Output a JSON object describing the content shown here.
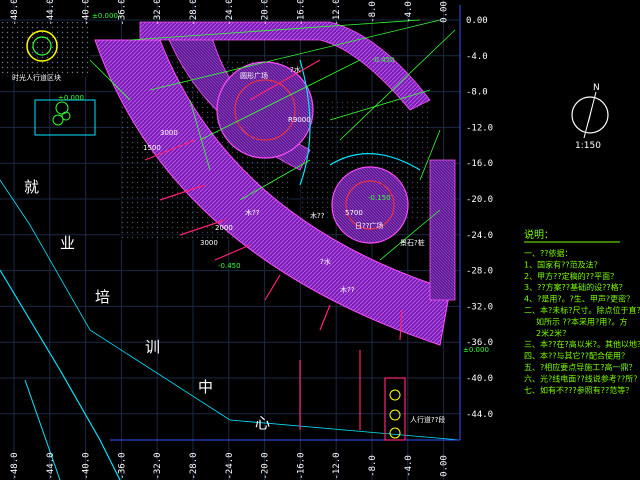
{
  "drawing": {
    "x_axis_labels": [
      "-48.0",
      "-44.0",
      "-40.0",
      "-36.0",
      "-32.0",
      "-28.0",
      "-24.0",
      "-20.0",
      "-16.0",
      "-12.0",
      "-8.0",
      "-4.0",
      "0.00"
    ],
    "y_axis_labels": [
      "0.00",
      "-4.0",
      "-8.0",
      "-12.0",
      "-16.0",
      "-20.0",
      "-24.0",
      "-28.0",
      "-32.0",
      "-36.0",
      "-40.0",
      "-44.0"
    ],
    "big_chars": [
      "就",
      "业",
      "培",
      "训",
      "中",
      "心"
    ],
    "scale": "1:150",
    "north_mark": "N",
    "notes_title": "说明：",
    "notes": [
      "一、??依据：",
      "1、国家有??范及法？",
      "2、甲方??定稿的??平面？",
      "3、??方案??基础的设??格？",
      "4、?是用?。?生、甲声?更密？",
      "二、本?未标?尺寸。除点位于直？",
      "如所示 ??本采用?用?。方",
      "2米2米？",
      "三、本??在?高以米?。其他以地？",
      "四、本??与其它??配合使用？",
      "五、?相应要点导施工?高一鼎？",
      "六、光?线电面??线说参考??所？",
      "七、如有不???参照有??范等？"
    ],
    "labels": {
      "top_left": "时光人行道区块",
      "plaza_1": "圆形广场",
      "plaza_2": "日??广场",
      "bottom_right": "人行道??段",
      "stone": "景石?桩",
      "elev_1": "±0.000",
      "elev_2": "-0.450",
      "elev_3": "±0.000",
      "elev_4": "-0.150",
      "elev_5": "-0.450",
      "elev_6": "±0.000",
      "wood_1": "木??",
      "wood_2": "木??",
      "wood_3": "木??",
      "path_1": "?水",
      "path_2": "?水",
      "dim_1": "3000",
      "dim_2": "3000",
      "dim_3": "1500",
      "dim_4": "5700",
      "dim_5": "2000",
      "dim_6": "R9000"
    }
  }
}
